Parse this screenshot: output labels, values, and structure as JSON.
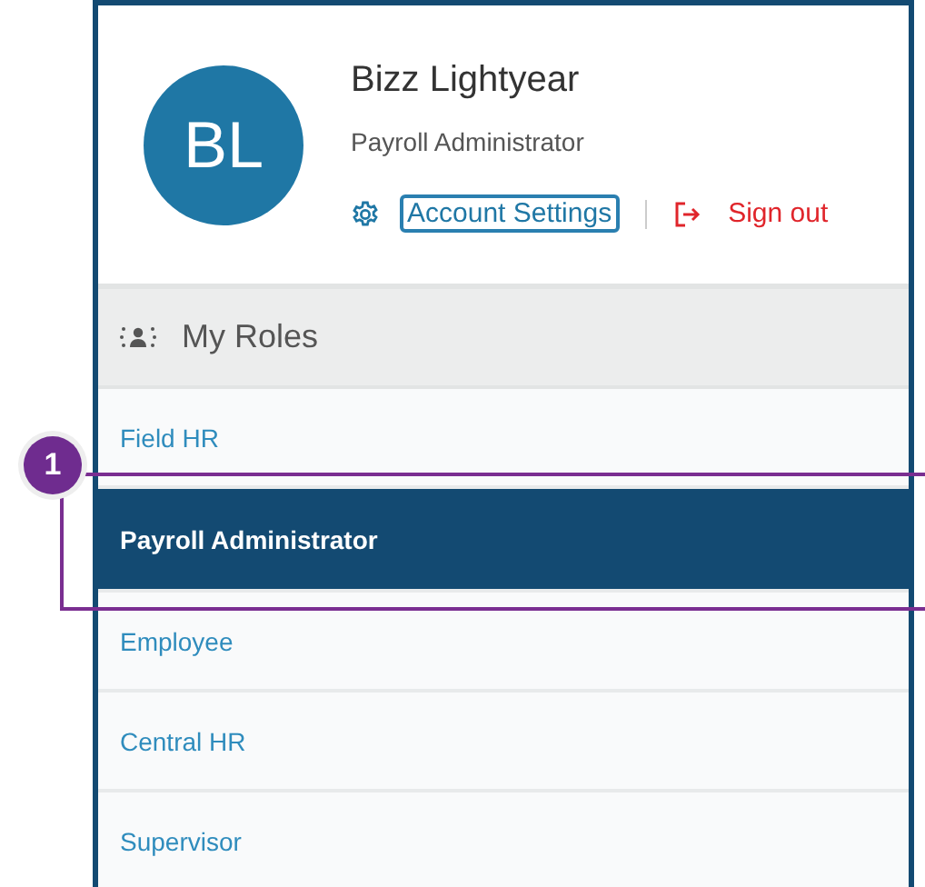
{
  "user": {
    "initials": "BL",
    "name": "Bizz Lightyear",
    "role": "Payroll Administrator"
  },
  "actions": [
    {
      "kind": "settings",
      "label": "Account Settings",
      "focused": true
    },
    {
      "kind": "signout",
      "label": "Sign out",
      "focused": false
    }
  ],
  "roles_header": {
    "title": "My Roles"
  },
  "roles": [
    {
      "label": "Field HR",
      "selected": false
    },
    {
      "label": "Payroll Administrator",
      "selected": true
    },
    {
      "label": "Employee",
      "selected": false
    },
    {
      "label": "Central HR",
      "selected": false
    },
    {
      "label": "Supervisor",
      "selected": false
    }
  ],
  "callout": {
    "number": "1"
  }
}
